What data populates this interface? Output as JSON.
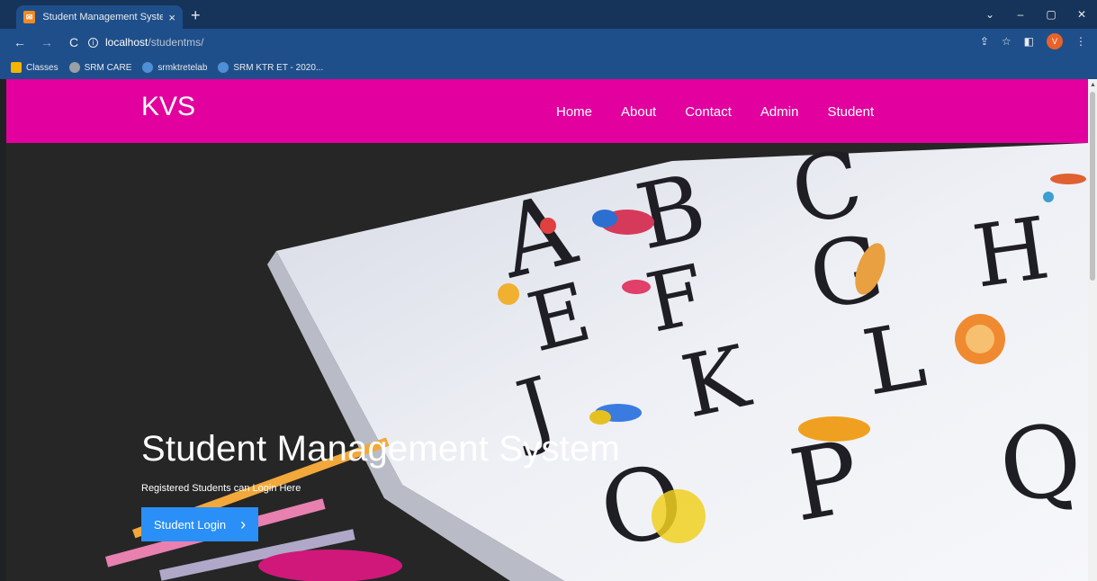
{
  "browser": {
    "tab_title": "Student Management System || H",
    "tab_close": "×",
    "new_tab": "+",
    "url_host": "localhost",
    "url_path": "/studentms/",
    "window_controls": [
      "⌄",
      "–",
      "▢",
      "✕"
    ],
    "bookmarks": [
      {
        "label": "Classes",
        "icon": "classroom-icon",
        "color": "#f4b400"
      },
      {
        "label": "SRM CARE",
        "icon": "srm-care-icon",
        "color": "#9aa0a6"
      },
      {
        "label": "srmktretelab",
        "icon": "cloud-icon",
        "color": "#4f8fd6"
      },
      {
        "label": "SRM KTR ET - 2020...",
        "icon": "cloud-icon",
        "color": "#4f8fd6"
      }
    ],
    "avatar_letter": "V"
  },
  "site": {
    "brand": "KVS",
    "menu": [
      "Home",
      "About",
      "Contact",
      "Admin",
      "Student"
    ],
    "accent": "#e2009e"
  },
  "hero": {
    "title": "Student Management System",
    "subtitle": "Registered Students can Login Here",
    "button_label": "Student Login",
    "button_arrow": "›",
    "button_color": "#2a8ff7"
  }
}
